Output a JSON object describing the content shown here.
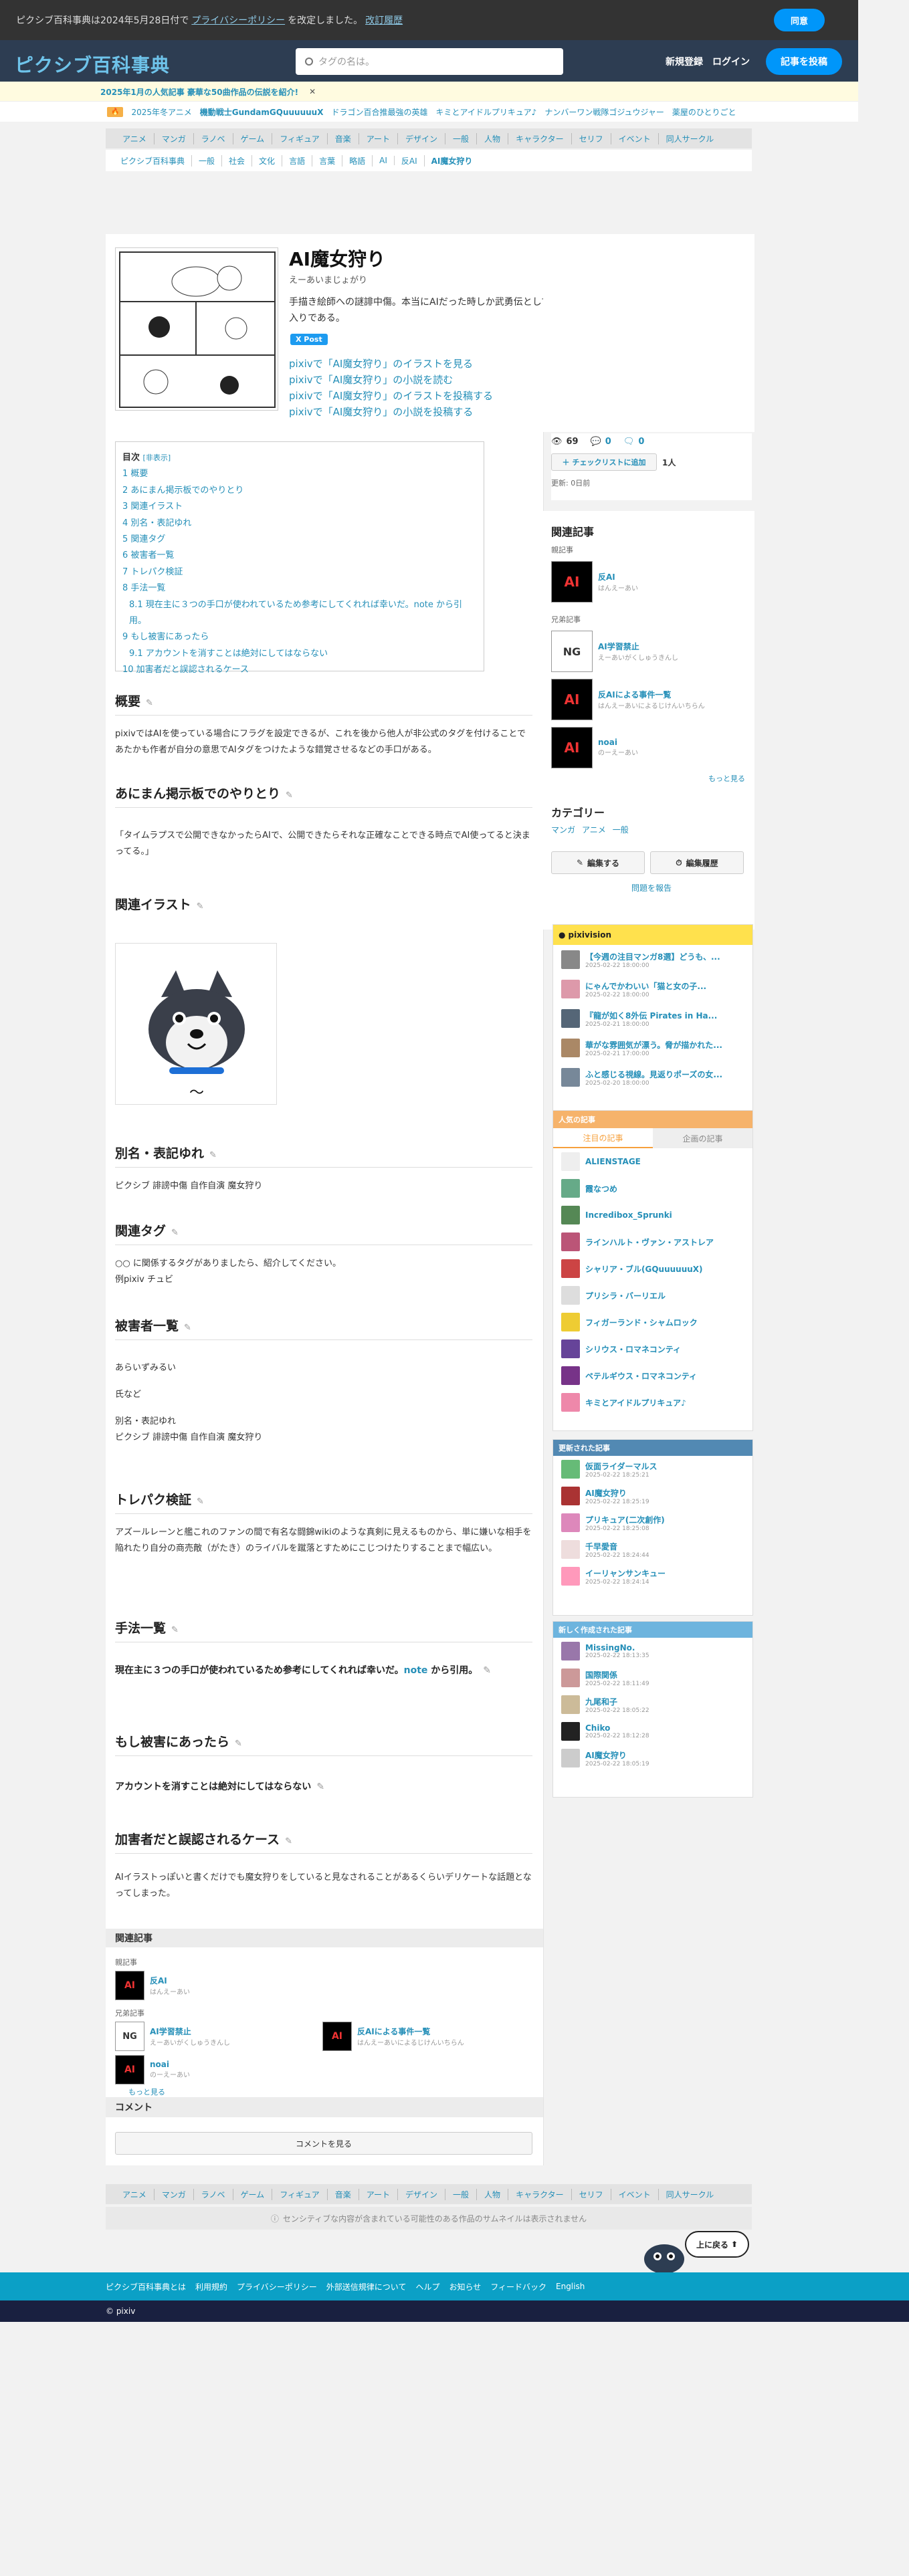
{
  "notice": {
    "text_a": "ピクシブ百科事典は2024年5月28日付で",
    "policy_link": "プライバシーポリシー",
    "text_b": "を改定しました。",
    "history_link": "改訂履歴",
    "agree": "同意"
  },
  "header": {
    "logo_a": "ピクシブ",
    "logo_b": "百科事典",
    "search_placeholder": "タグの名は。",
    "register": "新規登録",
    "login": "ログイン",
    "post": "記事を投稿"
  },
  "announcement": {
    "text": "2025年1月の人気記事 豪華な50曲作品の伝説を紹介!",
    "close": "✕"
  },
  "hot": {
    "badge": "🔥",
    "items": [
      "2025年冬アニメ",
      "機動戦士GundamGQuuuuuuX",
      "ドラゴン百合推最強の英雄",
      "キミとアイドルプリキュア♪",
      "ナンバーワン戦隊ゴジュウジャー",
      "薬屋のひとりごと"
    ]
  },
  "categories": [
    "アニメ",
    "マンガ",
    "ラノベ",
    "ゲーム",
    "フィギュア",
    "音楽",
    "アート",
    "デザイン",
    "一般",
    "人物",
    "キャラクター",
    "セリフ",
    "イベント",
    "同人サークル"
  ],
  "breadcrumb": [
    "ピクシブ百科事典",
    "一般",
    "社会",
    "文化",
    "言語",
    "言葉",
    "略語",
    "AI",
    "反AI",
    "AI魔女狩り"
  ],
  "article": {
    "title": "AI魔女狩り",
    "reading": "えーあいまじょがり",
    "description": "手描き絵師への謎誹中傷。本当にAIだった時しか武勇伝として語り継がれないためほとんどの場合が泣き寝入りである。",
    "xpost": "X Post",
    "pixiv_links": [
      "pixivで「AI魔女狩り」のイラストを見る",
      "pixivで「AI魔女狩り」の小説を読む",
      "pixivで「AI魔女狩り」のイラストを投稿する",
      "pixivで「AI魔女狩り」の小説を投稿する"
    ]
  },
  "toc": {
    "title": "目次",
    "toggle": "[非表示]",
    "items": [
      "1 概要",
      "2 あにまん掲示板でのやりとり",
      "3 関連イラスト",
      "4 別名・表記ゆれ",
      "5 関連タグ",
      "6 被害者一覧",
      "7 トレパク検証",
      "8 手法一覧",
      "8.1 現在主に３つの手口が使われているため参考にしてくれれば幸いだ。note から引用。",
      "9 もし被害にあったら",
      "9.1 アカウントを消すことは絶対にしてはならない",
      "10 加害者だと誤認されるケース"
    ]
  },
  "sections": {
    "overview": {
      "title": "概要",
      "text": "pixivではAIを使っている場合にフラグを設定できるが、これを後から他人が非公式のタグを付けることであたかも作者が自分の意思でAIタグをつけたような錯覚させるなどの手口がある。"
    },
    "animan": {
      "title": "あにまん掲示板でのやりとり",
      "text": "「タイムラプスで公開できなかったらAIで、公開できたらそれな正確なことできる時点でAI使ってると決まってる。」"
    },
    "illust": {
      "title": "関連イラスト"
    },
    "alias": {
      "title": "別名・表記ゆれ",
      "text": "ピクシブ 誹謗中傷 自作自演 魔女狩り"
    },
    "tags": {
      "title": "関連タグ",
      "text": "○○ に関係するタグがありましたら、紹介してください。",
      "example": "例pixiv チュビ"
    },
    "victims": {
      "title": "被害者一覧",
      "name": "あらいずみるい",
      "others": "氏など",
      "alias_label": "別名・表記ゆれ",
      "alias": "ピクシブ 誹謗中傷 自作自演 魔女狩り"
    },
    "trace": {
      "title": "トレパク検証",
      "text": "アズールレーンと艦これのファンの間で有名な闘錦wikiのような真剣に見えるものから、単に嫌いな相手を陥れたり自分の商売敵（がたき）のライバルを蹴落とすためにこじつけたりすることまで幅広い。"
    },
    "methods": {
      "title": "手法一覧",
      "sub_a": "現在主に３つの手口が使われているため参考にしてくれれば幸いだ。",
      "sub_link": "note",
      "sub_b": " から引用。"
    },
    "damage": {
      "title": "もし被害にあったら",
      "sub": "アカウントを消すことは絶対にしてはならない"
    },
    "misidentified": {
      "title": "加害者だと誤認されるケース",
      "text": "AIイラストっぽいと書くだけでも魔女狩りをしていると見なされることがあるくらいデリケートな話題となってしまった。"
    }
  },
  "related_bottom": {
    "head": "関連記事",
    "parent_label": "親記事",
    "parent": {
      "title": "反AI",
      "reading": "はんえーあい",
      "icon": "AI"
    },
    "sibling_label": "兄弟記事",
    "siblings": [
      {
        "title": "AI学習禁止",
        "reading": "えーあいがくしゅうきんし",
        "icon": "NG"
      },
      {
        "title": "反AIによる事件一覧",
        "reading": "はんえーあいによるじけんいちらん",
        "icon": "AI"
      },
      {
        "title": "noai",
        "reading": "のーえーあい",
        "icon": "AI"
      }
    ],
    "more": "もっと見る",
    "comment_head": "コメント",
    "comment_btn": "コメントを見る"
  },
  "sidebar": {
    "views": "69",
    "comments": "0",
    "replies": "0",
    "checklist": "チェックリストに追加",
    "people": "1人",
    "updated": "更新: 0日前",
    "related_head": "関連記事",
    "parent_label": "親記事",
    "parent": {
      "title": "反AI",
      "reading": "はんえーあい"
    },
    "sibling_label": "兄弟記事",
    "siblings": [
      {
        "title": "AI学習禁止",
        "reading": "えーあいがくしゅうきんし",
        "icon": "NG"
      },
      {
        "title": "反AIによる事件一覧",
        "reading": "はんえーあいによるじけんいちらん",
        "icon": "AI"
      },
      {
        "title": "noai",
        "reading": "のーえーあい",
        "icon": "AI"
      }
    ],
    "more": "もっと見る",
    "category_head": "カテゴリー",
    "categories": [
      "マンガ",
      "アニメ",
      "一般"
    ],
    "edit": "編集する",
    "history": "編集履歴",
    "report": "問題を報告"
  },
  "pixivision": {
    "head": "pixivision",
    "items": [
      {
        "title": "【今週の注目マンガ8選】どうも、...",
        "date": "2025-02-22 18:00:00"
      },
      {
        "title": "にゃんでかわいい「猫と女の子...",
        "date": "2025-02-22 18:00:00"
      },
      {
        "title": "『龍が如く8外伝 Pirates in Ha...",
        "date": "2025-02-21 18:00:00"
      },
      {
        "title": "華がな雰囲気が漂う。脅が描かれた...",
        "date": "2025-02-21 17:00:00"
      },
      {
        "title": "ふと感じる視線。見返りポーズの女...",
        "date": "2025-02-20 18:00:00"
      }
    ]
  },
  "popular": {
    "head": "人気の記事",
    "tab_a": "注目の記事",
    "tab_b": "企画の記事",
    "items": [
      "ALIENSTAGE",
      "霞なつめ",
      "Incredibox_Sprunki",
      "ラインハルト・ヴァン・アストレア",
      "シャリア・ブル(GQuuuuuuX)",
      "プリシラ・バーリエル",
      "フィガーランド・シャムロック",
      "シリウス・ロマネコンティ",
      "ペテルギウス・ロマネコンティ",
      "キミとアイドルプリキュア♪"
    ]
  },
  "updated": {
    "head": "更新された記事",
    "items": [
      {
        "title": "仮面ライダーマルス",
        "date": "2025-02-22 18:25:21"
      },
      {
        "title": "AI魔女狩り",
        "date": "2025-02-22 18:25:19"
      },
      {
        "title": "プリキュア(二次創作)",
        "date": "2025-02-22 18:25:08"
      },
      {
        "title": "千早愛音",
        "date": "2025-02-22 18:24:44"
      },
      {
        "title": "イーリャンサンキュー",
        "date": "2025-02-22 18:24:14"
      }
    ]
  },
  "newest": {
    "head": "新しく作成された記事",
    "items": [
      {
        "title": "MissingNo.",
        "date": "2025-02-22 18:13:35"
      },
      {
        "title": "国際関係",
        "date": "2025-02-22 18:11:49"
      },
      {
        "title": "九尾和子",
        "date": "2025-02-22 18:05:22"
      },
      {
        "title": "Chiko",
        "date": "2025-02-22 18:12:28"
      },
      {
        "title": "AI魔女狩り",
        "date": "2025-02-22 18:05:19"
      }
    ]
  },
  "sensitive": "センシティブな内容が含まれている可能性のある作品のサムネイルは表示されません",
  "totop": "上に戻る",
  "footer": {
    "links": [
      "ピクシブ百科事典とは",
      "利用規約",
      "プライバシーポリシー",
      "外部送信規律について",
      "ヘルプ",
      "お知らせ",
      "フィードバック",
      "English"
    ],
    "copyright": "© pixiv"
  },
  "colors": {
    "accent": "#0096fa",
    "link": "#258fb8",
    "header": "#2d3d52",
    "pixivision": "#ffe14d",
    "popular": "#f6b36b",
    "updated": "#5289b3",
    "newest": "#6db4de",
    "footer": "#0ba0c6"
  }
}
